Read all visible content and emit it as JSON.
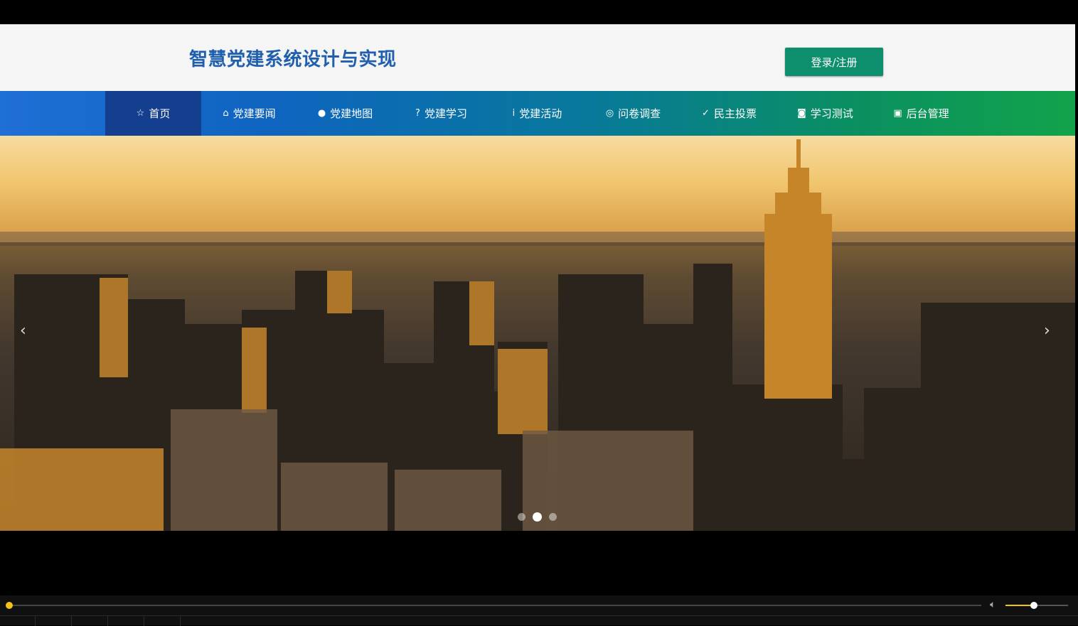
{
  "header": {
    "title": "智慧党建系统设计与实现",
    "login_label": "登录/注册"
  },
  "nav": {
    "items": [
      {
        "label": "首页",
        "icon": "star-icon",
        "glyph": "☆",
        "active": true
      },
      {
        "label": "党建要闻",
        "icon": "bag-icon",
        "glyph": "⌂",
        "active": false
      },
      {
        "label": "党建地图",
        "icon": "info-circle-icon",
        "glyph": "●",
        "active": false
      },
      {
        "label": "党建学习",
        "icon": "question-circle-icon",
        "glyph": "?",
        "active": false
      },
      {
        "label": "党建活动",
        "icon": "info-icon",
        "glyph": "i",
        "active": false
      },
      {
        "label": "问卷调查",
        "icon": "dollar-circle-icon",
        "glyph": "◎",
        "active": false
      },
      {
        "label": "民主投票",
        "icon": "check-circle-icon",
        "glyph": "✓",
        "active": false
      },
      {
        "label": "学习测试",
        "icon": "camera-icon",
        "glyph": "◙",
        "active": false
      },
      {
        "label": "后台管理",
        "icon": "gift-icon",
        "glyph": "▣",
        "active": false
      }
    ]
  },
  "banner": {
    "prev_glyph": "‹",
    "next_glyph": "›",
    "slide_count": 3,
    "active_slide": 2
  },
  "player": {
    "progress": 0.0,
    "volume": 0.45
  },
  "colors": {
    "title": "#1f5fae",
    "login_button": "#0d8f6e",
    "nav_active": "#143f8f",
    "accent": "#f2c21b"
  }
}
